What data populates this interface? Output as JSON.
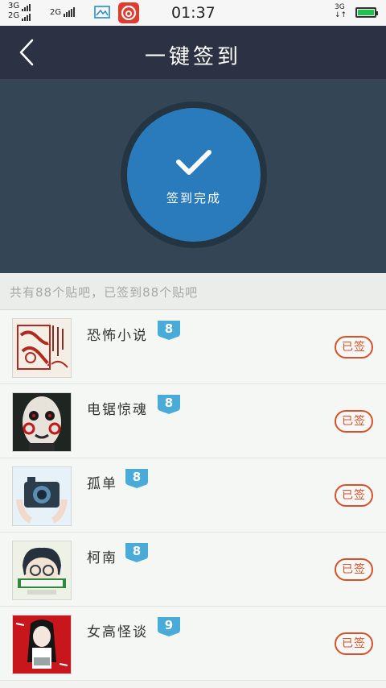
{
  "status_bar": {
    "net1": "3G",
    "net2": "2G",
    "net3": "2G",
    "net_right": "3G",
    "time": "01:37"
  },
  "header": {
    "title": "一键签到"
  },
  "hero": {
    "status_text": "签到完成"
  },
  "summary": {
    "text": "共有88个贴吧，已签到88个贴吧"
  },
  "list": {
    "items": [
      {
        "name": "恐怖小说",
        "level": "8",
        "status": "已签",
        "level_color": "#4aaad8"
      },
      {
        "name": "电锯惊魂",
        "level": "8",
        "status": "已签",
        "level_color": "#4aaad8"
      },
      {
        "name": "孤单",
        "level": "8",
        "status": "已签",
        "level_color": "#4aaad8"
      },
      {
        "name": "柯南",
        "level": "8",
        "status": "已签",
        "level_color": "#4aaad8"
      },
      {
        "name": "女高怪谈",
        "level": "9",
        "status": "已签",
        "level_color": "#4aaad8"
      }
    ]
  },
  "colors": {
    "header_bg": "#2c3143",
    "hero_bg": "#344655",
    "circle": "#2a7bbc",
    "signed_red": "#d9502b"
  }
}
